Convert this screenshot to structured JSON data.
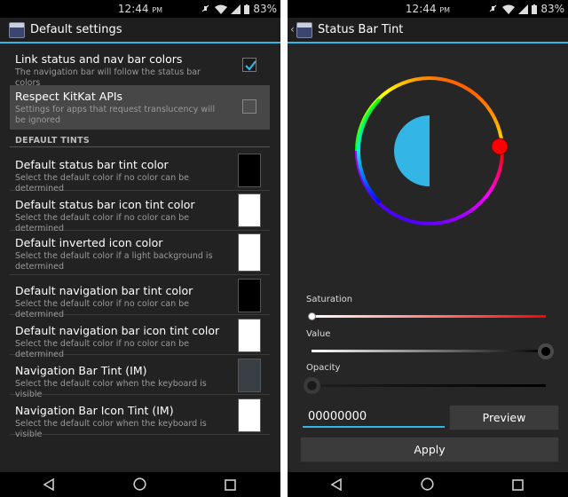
{
  "status_bar": {
    "time": "12:44",
    "ampm": "PM",
    "battery": "83%"
  },
  "left": {
    "title": "Default settings",
    "link_colors": {
      "title": "Link status and nav bar colors",
      "subtitle": "The navigation bar will follow the status bar colors",
      "checked": true
    },
    "kitkat": {
      "title": "Respect KitKat APIs",
      "subtitle": "Settings for apps that request translucency will be ignored",
      "checked": false
    },
    "section_header": "DEFAULT TINTS",
    "tints": [
      {
        "title": "Default status bar tint color",
        "subtitle": "Select the default color if no color can be determined",
        "color": "#000000"
      },
      {
        "title": "Default status bar icon tint color",
        "subtitle": "Select the default color if no color can be determined",
        "color": "#ffffff"
      },
      {
        "title": "Default inverted icon color",
        "subtitle": "Select the default color if a light background is determined",
        "color": "#ffffff"
      },
      {
        "title": "Default navigation bar tint color",
        "subtitle": "Select the default color if no color can be determined",
        "color": "#000000"
      },
      {
        "title": "Default navigation bar icon tint color",
        "subtitle": "Select the default color if no color can be determined",
        "color": "#ffffff"
      },
      {
        "title": "Navigation Bar Tint (IM)",
        "subtitle": "Select the default color when the keyboard is visible",
        "color": "#3a3f45"
      },
      {
        "title": "Navigation Bar Icon Tint (IM)",
        "subtitle": "Select the default color when the keyboard is visible",
        "color": "#ffffff"
      }
    ]
  },
  "right": {
    "title": "Status Bar Tint",
    "picker": {
      "hue_color": "#ff0000",
      "preview_color": "#33b5e5",
      "center_fill": "#262626"
    },
    "saturation": {
      "label": "Saturation",
      "value": 0
    },
    "value": {
      "label": "Value",
      "value": 1
    },
    "opacity": {
      "label": "Opacity",
      "value": 0
    },
    "hex_value": "00000000",
    "preview_label": "Preview",
    "apply_label": "Apply"
  },
  "icons": {
    "status": [
      "mute-icon",
      "wifi-icon",
      "signal-icon",
      "battery-icon"
    ],
    "nav": [
      "back-icon",
      "home-icon",
      "recents-icon"
    ]
  }
}
